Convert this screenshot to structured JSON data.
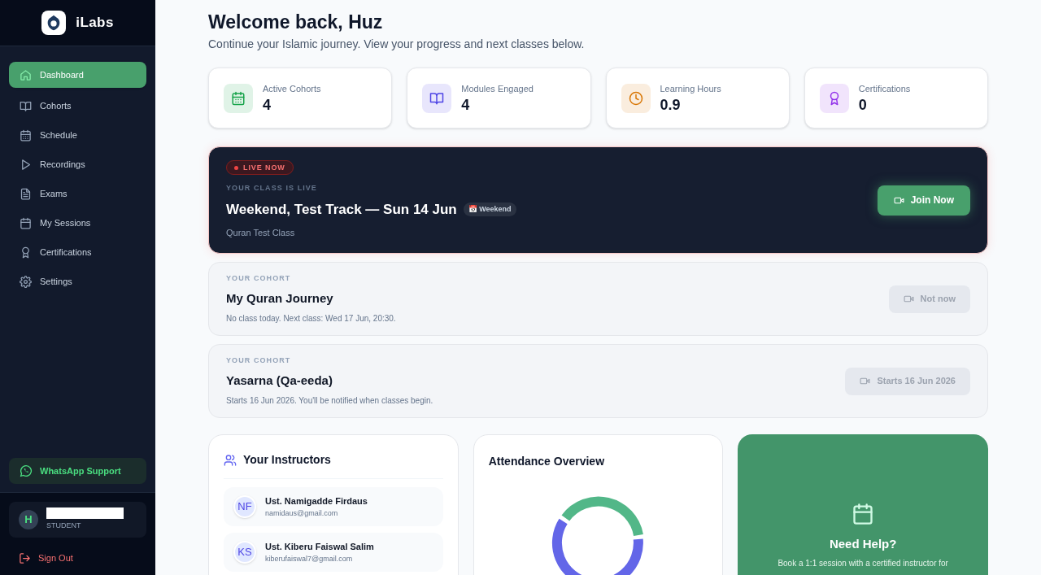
{
  "brand": {
    "name": "iLabs"
  },
  "nav": [
    {
      "label": "Dashboard",
      "kind": "home",
      "selected": true
    },
    {
      "label": "Cohorts",
      "kind": "book",
      "selected": false
    },
    {
      "label": "Schedule",
      "kind": "calendar",
      "selected": false
    },
    {
      "label": "Recordings",
      "kind": "play",
      "selected": false
    },
    {
      "label": "Exams",
      "kind": "file",
      "selected": false
    },
    {
      "label": "My Sessions",
      "kind": "calendar2",
      "selected": false
    },
    {
      "label": "Certifications",
      "kind": "award",
      "selected": false
    },
    {
      "label": "Settings",
      "kind": "gear",
      "selected": false
    }
  ],
  "support": {
    "label": "WhatsApp Support"
  },
  "user": {
    "initial": "H",
    "role": "STUDENT"
  },
  "sign_out": {
    "label": "Sign Out"
  },
  "header": {
    "title": "Welcome back, Huz",
    "subtitle": "Continue your Islamic journey. View your progress and next classes below."
  },
  "stats": [
    {
      "label": "Active Cohorts",
      "value": "4",
      "kind": "calendar",
      "color": "#16a34a"
    },
    {
      "label": "Modules Engaged",
      "value": "4",
      "kind": "book",
      "color": "#4f46e5"
    },
    {
      "label": "Learning Hours",
      "value": "0.9",
      "kind": "clock",
      "color": "#d97706"
    },
    {
      "label": "Certifications",
      "value": "0",
      "kind": "award",
      "color": "#9333ea"
    }
  ],
  "classes": [
    {
      "kind": "live",
      "badge": "LIVE NOW",
      "eyebrow": "YOUR CLASS IS LIVE",
      "title": "Weekend, Test Track — Sun 14 Jun",
      "tag": "📅 Weekend",
      "subtitle": "Quran Test Class",
      "button": "Join Now",
      "disabled": false
    },
    {
      "kind": "cohort",
      "eyebrow": "YOUR COHORT",
      "title": "My Quran Journey",
      "subtitle": "No class today. Next class: Wed 17 Jun, 20:30.",
      "button": "Not now",
      "disabled": true
    },
    {
      "kind": "cohort",
      "eyebrow": "YOUR COHORT",
      "title": "Yasarna (Qa-eeda)",
      "subtitle": "Starts 16 Jun 2026. You'll be notified when classes begin.",
      "button": "Starts 16 Jun 2026",
      "disabled": true
    }
  ],
  "instructors": {
    "title": "Your Instructors",
    "items": [
      {
        "initials": "NF",
        "name": "Ust. Namigadde Firdaus",
        "email": "namidaus@gmail.com"
      },
      {
        "initials": "KS",
        "name": "Ust. Kiberu Faiswal Salim",
        "email": "kiberufaiswal7@gmail.com"
      }
    ]
  },
  "attendance": {
    "title": "Attendance Overview"
  },
  "help": {
    "title": "Need Help?",
    "text": "Book a 1:1 session with a certified instructor for"
  }
}
